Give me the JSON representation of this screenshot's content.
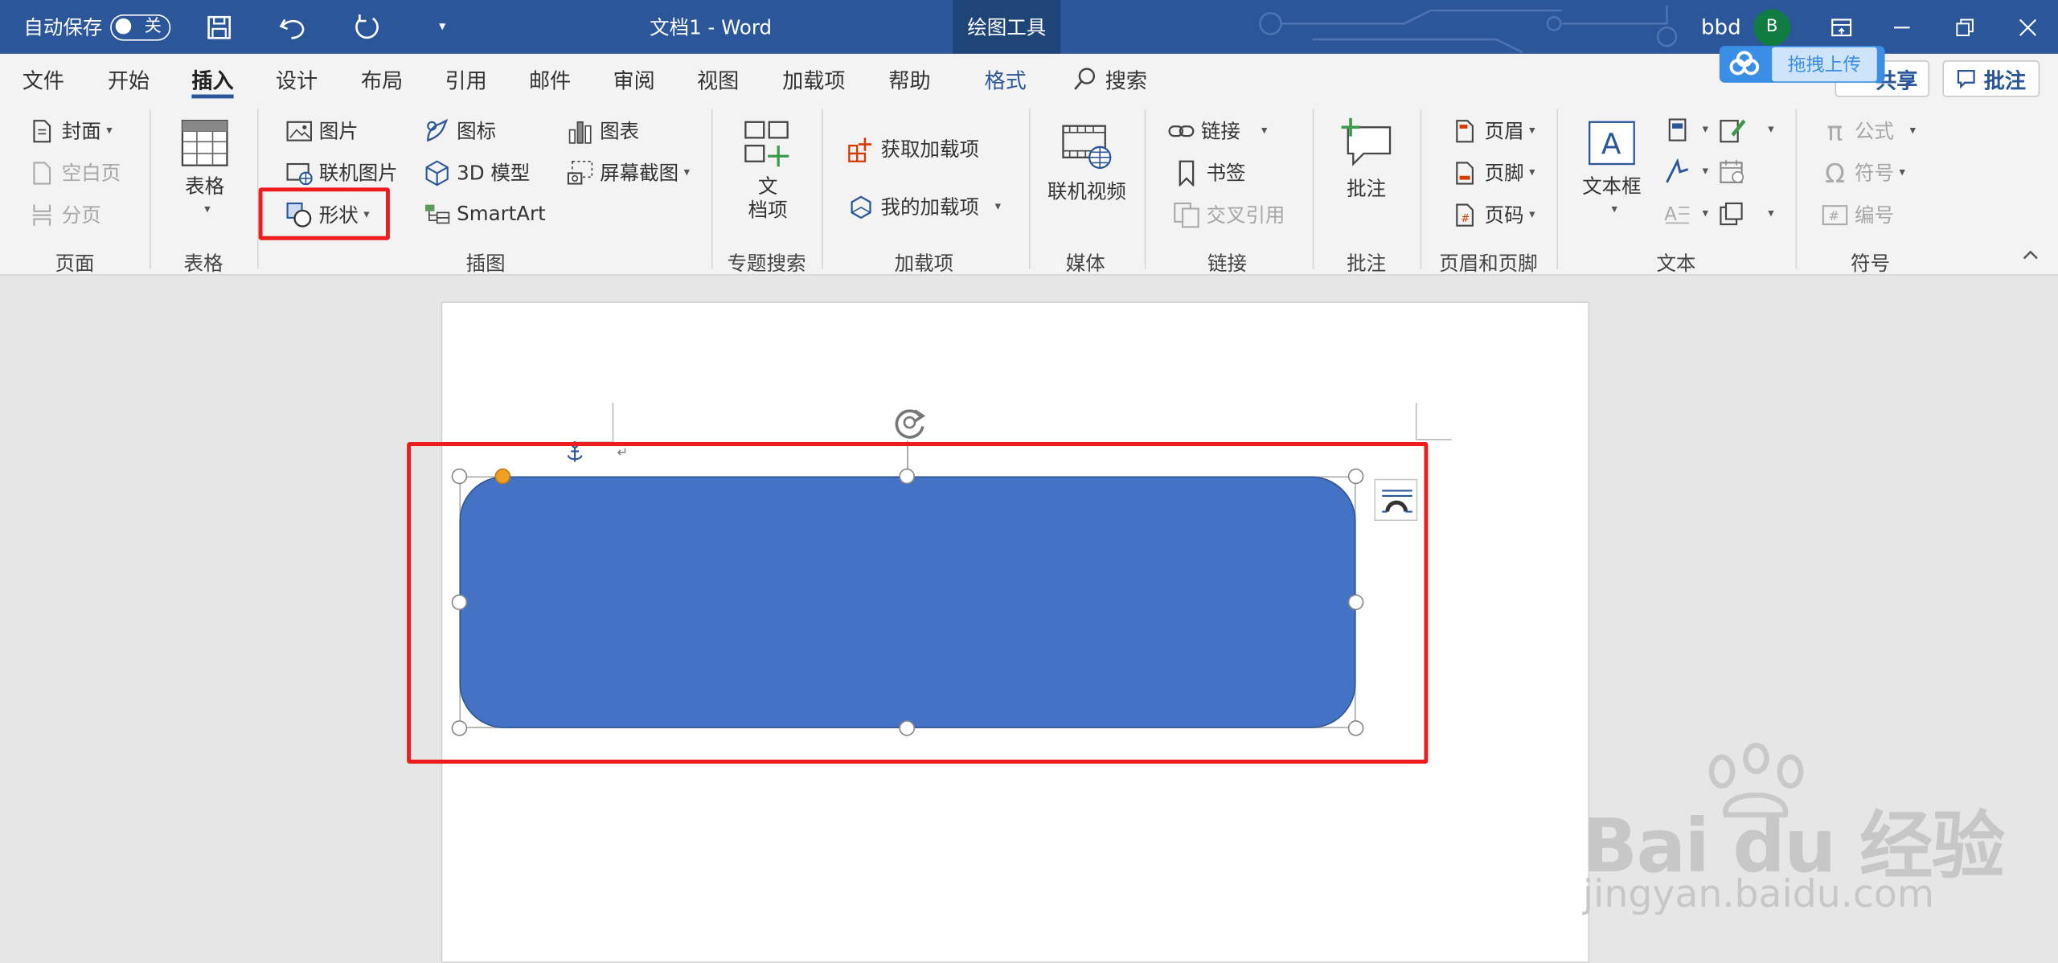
{
  "titlebar": {
    "autosave_label": "自动保存",
    "autosave_state": "关",
    "doc_title": "文档1  -  Word",
    "context_tab": "绘图工具",
    "user_name": "bbd",
    "avatar_initial": "B"
  },
  "tabs": [
    "文件",
    "开始",
    "插入",
    "设计",
    "布局",
    "引用",
    "邮件",
    "审阅",
    "视图",
    "加载项",
    "帮助",
    "格式"
  ],
  "active_tab": "插入",
  "search_label": "搜索",
  "share_label": "共享",
  "comment_btn_label": "批注",
  "upload_label": "拖拽上传",
  "ribbon": {
    "pages": {
      "cover": "封面",
      "blank": "空白页",
      "break": "分页",
      "label": "页面"
    },
    "tables": {
      "table": "表格",
      "label": "表格"
    },
    "illustrations": {
      "picture": "图片",
      "online_picture": "联机图片",
      "shapes": "形状",
      "icons": "图标",
      "model3d": "3D 模型",
      "smartart": "SmartArt",
      "chart": "图表",
      "screenshot": "屏幕截图",
      "label": "插图"
    },
    "topic": {
      "doc_item_line1": "文",
      "doc_item_line2": "档项",
      "label": "专题搜索"
    },
    "addins": {
      "get": "获取加载项",
      "my": "我的加载项",
      "label": "加载项"
    },
    "media": {
      "video": "联机视频",
      "label": "媒体"
    },
    "links": {
      "link": "链接",
      "bookmark": "书签",
      "crossref": "交叉引用",
      "label": "链接"
    },
    "comments": {
      "comment": "批注",
      "label": "批注"
    },
    "header_footer": {
      "header": "页眉",
      "footer": "页脚",
      "page_number": "页码",
      "label": "页眉和页脚"
    },
    "text": {
      "textbox": "文本框",
      "label": "文本"
    },
    "symbols": {
      "equation": "公式",
      "symbol": "符号",
      "number": "编号",
      "label": "符号"
    }
  },
  "colors": {
    "titlebar": "#2b579a",
    "shape_fill": "#4472c4",
    "highlight": "#ee1c1c"
  },
  "watermark": {
    "brand": "Bai  du 经验",
    "url": "jingyan.baidu.com"
  }
}
